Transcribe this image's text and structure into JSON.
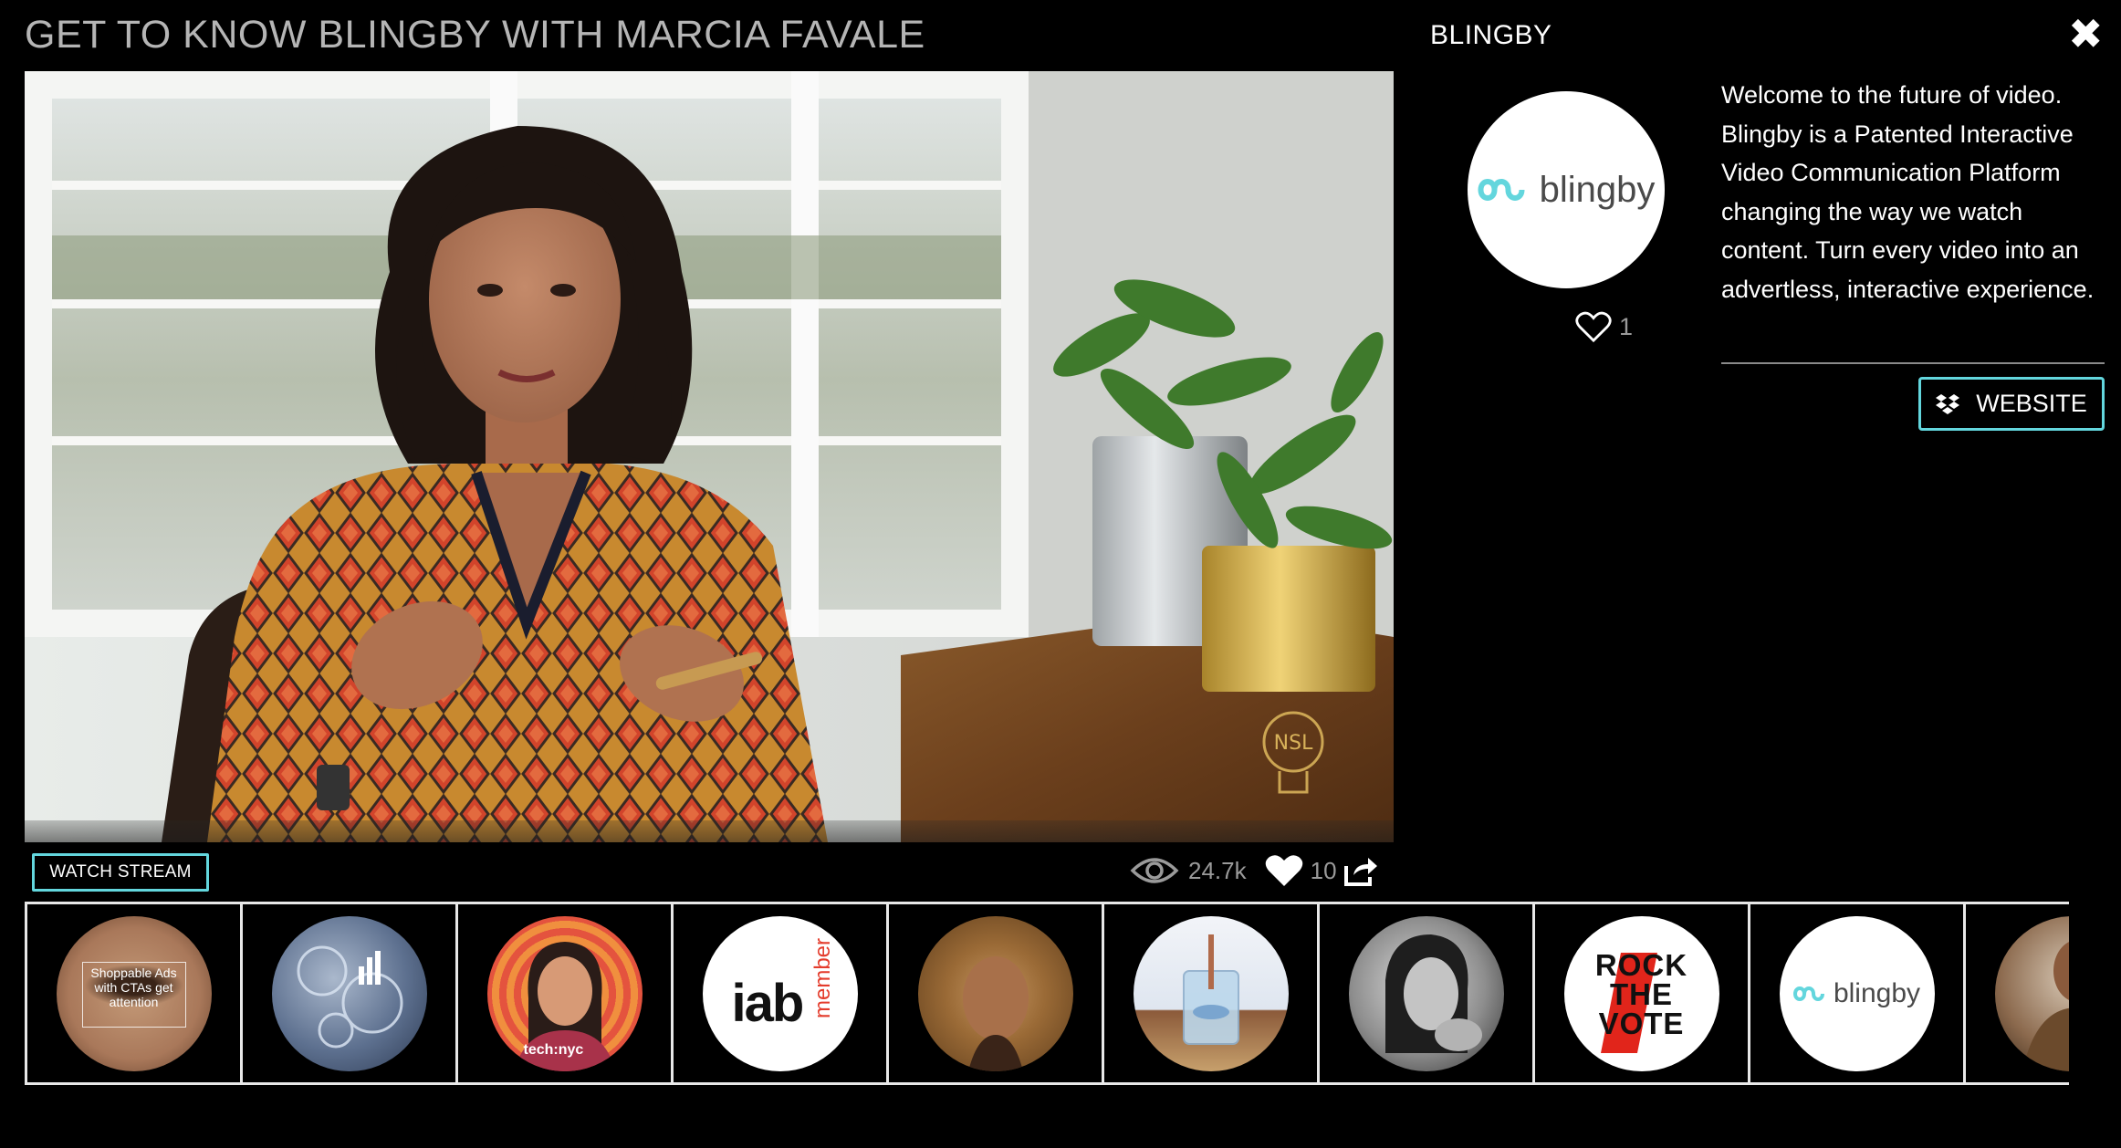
{
  "video": {
    "title": "GET TO KNOW BLINGBY WITH MARCIA FAVALE",
    "watermark": "NSL"
  },
  "controls": {
    "watch_stream_label": "WATCH STREAM",
    "views": "24.7k",
    "likes": "10"
  },
  "channel": {
    "name": "BLINGBY",
    "logo_text": "blingby",
    "likes": "1",
    "description": "Welcome to the future of video. Blingby is a Patented Interactive Video Communication Platform changing the way we watch content. Turn every video into an advertless, interactive experience.",
    "website_label": "WEBSITE"
  },
  "thumbnails": [
    {
      "name": "shoppable-ads",
      "caption": "Shoppable Ads with CTAs get attention"
    },
    {
      "name": "analytics-gears"
    },
    {
      "name": "techbyc-illustration",
      "caption": "tech:nyc"
    },
    {
      "name": "iab-member",
      "caption_main": "iab",
      "caption_side": "member"
    },
    {
      "name": "curly-hair-portrait"
    },
    {
      "name": "glass-product"
    },
    {
      "name": "bw-portrait"
    },
    {
      "name": "rock-the-vote",
      "lines": [
        "ROCK",
        "THE",
        "VOTE"
      ]
    },
    {
      "name": "blingby-logo",
      "caption": "blingby"
    },
    {
      "name": "partial-portrait"
    }
  ],
  "colors": {
    "accent": "#63d6dd",
    "title_gray": "#b5b5b5",
    "stat_gray": "#9a9a9a",
    "background": "#000000"
  },
  "icons": {
    "close": "close-icon",
    "eye": "eye-icon",
    "heart": "heart-icon",
    "share": "share-icon",
    "dropbox": "dropbox-icon"
  }
}
